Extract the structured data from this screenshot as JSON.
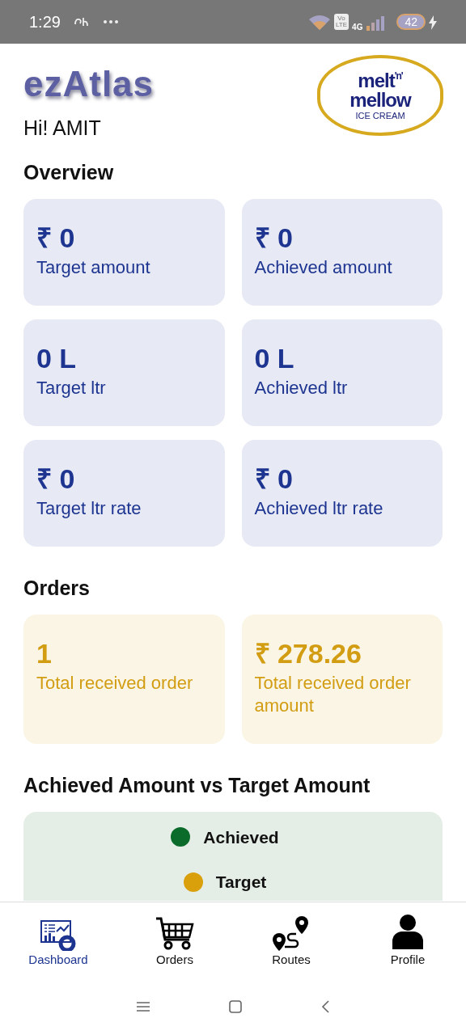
{
  "status_bar": {
    "time": "1:29",
    "network": "4G",
    "volte": [
      "Vo",
      "LTE"
    ],
    "battery": "42"
  },
  "header": {
    "app_title": "ezAtlas",
    "greeting": "Hi! AMIT",
    "brand_logo": {
      "line1": "melt",
      "joiner": "'n'",
      "line2": "mellow",
      "subtitle": "ICE CREAM"
    }
  },
  "overview": {
    "title": "Overview",
    "cards": [
      {
        "value": "₹ 0",
        "label": "Target amount"
      },
      {
        "value": "₹ 0",
        "label": "Achieved amount"
      },
      {
        "value": "0 L",
        "label": "Target ltr"
      },
      {
        "value": "0 L",
        "label": "Achieved ltr"
      },
      {
        "value": "₹ 0",
        "label": "Target ltr rate"
      },
      {
        "value": "₹ 0",
        "label": "Achieved ltr rate"
      }
    ]
  },
  "orders": {
    "title": "Orders",
    "cards": [
      {
        "value": "1",
        "label": "Total received order"
      },
      {
        "value": "₹ 278.26",
        "label": "Total received  order amount"
      }
    ]
  },
  "comparison": {
    "title": "Achieved Amount vs Target Amount",
    "legend": [
      {
        "label": "Achieved",
        "color": "#0b6b2a"
      },
      {
        "label": "Target",
        "color": "#d9a00c"
      }
    ]
  },
  "bottom_nav": [
    {
      "kind": "dashboard",
      "label": "Dashboard",
      "selected": true
    },
    {
      "kind": "cart",
      "label": "Orders",
      "selected": false
    },
    {
      "kind": "route",
      "label": "Routes",
      "selected": false
    },
    {
      "kind": "person",
      "label": "Profile",
      "selected": false
    }
  ]
}
